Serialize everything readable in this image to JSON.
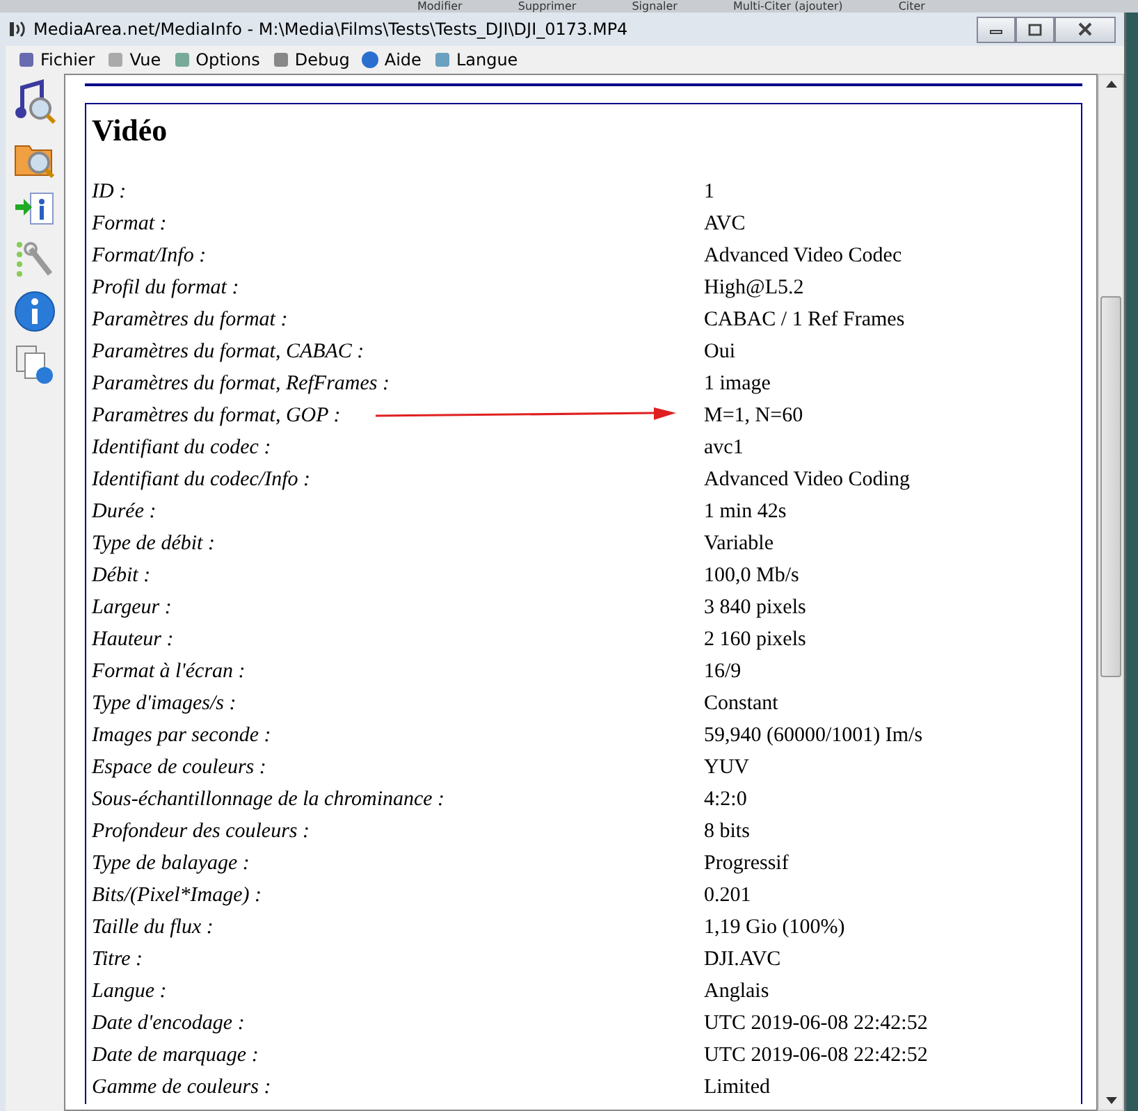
{
  "background_buttons": [
    "Modifier",
    "Supprimer",
    "Signaler",
    "Multi-Citer (ajouter)",
    "Citer"
  ],
  "window": {
    "title": "MediaArea.net/MediaInfo - M:\\Media\\Films\\Tests\\Tests_DJI\\DJI_0173.MP4"
  },
  "menu": [
    "Fichier",
    "Vue",
    "Options",
    "Debug",
    "Aide",
    "Langue"
  ],
  "section": {
    "title": "Vidéo",
    "rows": [
      {
        "label": "ID :",
        "value": "1"
      },
      {
        "label": "Format :",
        "value": "AVC"
      },
      {
        "label": "Format/Info :",
        "value": "Advanced Video Codec"
      },
      {
        "label": "Profil du format :",
        "value": "High@L5.2"
      },
      {
        "label": "Paramètres du format :",
        "value": "CABAC / 1 Ref Frames"
      },
      {
        "label": "Paramètres du format, CABAC :",
        "value": "Oui"
      },
      {
        "label": "Paramètres du format, RefFrames :",
        "value": "1 image"
      },
      {
        "label": "Paramètres du format, GOP :",
        "value": "M=1, N=60",
        "arrow": true
      },
      {
        "label": "Identifiant du codec :",
        "value": "avc1"
      },
      {
        "label": "Identifiant du codec/Info :",
        "value": "Advanced Video Coding"
      },
      {
        "label": "Durée :",
        "value": "1 min 42s"
      },
      {
        "label": "Type de débit :",
        "value": "Variable"
      },
      {
        "label": "Débit :",
        "value": "100,0 Mb/s"
      },
      {
        "label": "Largeur :",
        "value": "3 840 pixels"
      },
      {
        "label": "Hauteur :",
        "value": "2 160 pixels"
      },
      {
        "label": "Format à l'écran :",
        "value": "16/9"
      },
      {
        "label": "Type d'images/s :",
        "value": "Constant"
      },
      {
        "label": "Images par seconde :",
        "value": "59,940 (60000/1001) Im/s"
      },
      {
        "label": "Espace de couleurs :",
        "value": "YUV"
      },
      {
        "label": "Sous-échantillonnage de la chrominance :",
        "value": "4:2:0"
      },
      {
        "label": "Profondeur des couleurs :",
        "value": "8 bits"
      },
      {
        "label": "Type de balayage :",
        "value": "Progressif"
      },
      {
        "label": "Bits/(Pixel*Image) :",
        "value": "0.201"
      },
      {
        "label": "Taille du flux :",
        "value": "1,19 Gio (100%)"
      },
      {
        "label": "Titre :",
        "value": "DJI.AVC"
      },
      {
        "label": "Langue :",
        "value": "Anglais"
      },
      {
        "label": "Date d'encodage :",
        "value": "UTC 2019-06-08 22:42:52"
      },
      {
        "label": "Date de marquage :",
        "value": "UTC 2019-06-08 22:42:52"
      },
      {
        "label": "Gamme de couleurs :",
        "value": "Limited"
      }
    ]
  }
}
